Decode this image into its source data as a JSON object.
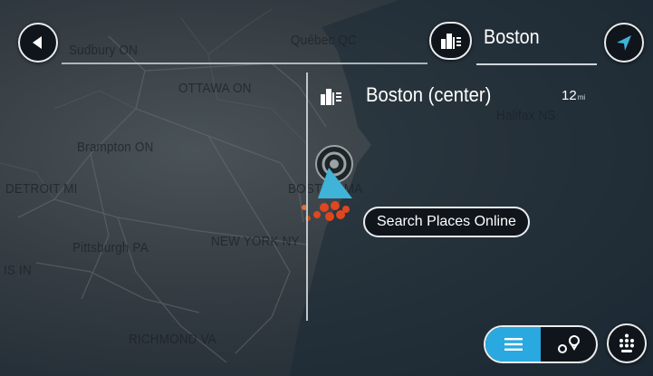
{
  "search": {
    "query": "Boston",
    "field_text": "Sudbury ON"
  },
  "map": {
    "cities": [
      {
        "id": "sudbury",
        "label": "Sudbury ON"
      },
      {
        "id": "quebec",
        "label": "Québec QC"
      },
      {
        "id": "ottawa",
        "label": "OTTAWA ON"
      },
      {
        "id": "halifax",
        "label": "Halifax NS"
      },
      {
        "id": "brampton",
        "label": "Brampton ON"
      },
      {
        "id": "detroit",
        "label": "DETROIT MI"
      },
      {
        "id": "boston",
        "label": "BOSTON MA"
      },
      {
        "id": "newyork",
        "label": "NEW YORK NY"
      },
      {
        "id": "pittsburgh",
        "label": "Pittsburgh PA"
      },
      {
        "id": "indiana",
        "label": "IS IN"
      },
      {
        "id": "richmond",
        "label": "RICHMOND VA"
      }
    ]
  },
  "result": {
    "name": "Boston (center)",
    "distance": "12",
    "unit": "mi"
  },
  "buttons": {
    "search_online": "Search Places Online"
  },
  "colors": {
    "accent": "#29a9e0",
    "button_bg": "#0f151b",
    "button_border": "#e9ecef"
  },
  "icons": {
    "back": "back-arrow-icon",
    "category": "city-icon",
    "navigate": "navigation-arrow-icon",
    "list": "list-icon",
    "map": "map-pins-icon",
    "keyboard": "keyboard-icon"
  }
}
